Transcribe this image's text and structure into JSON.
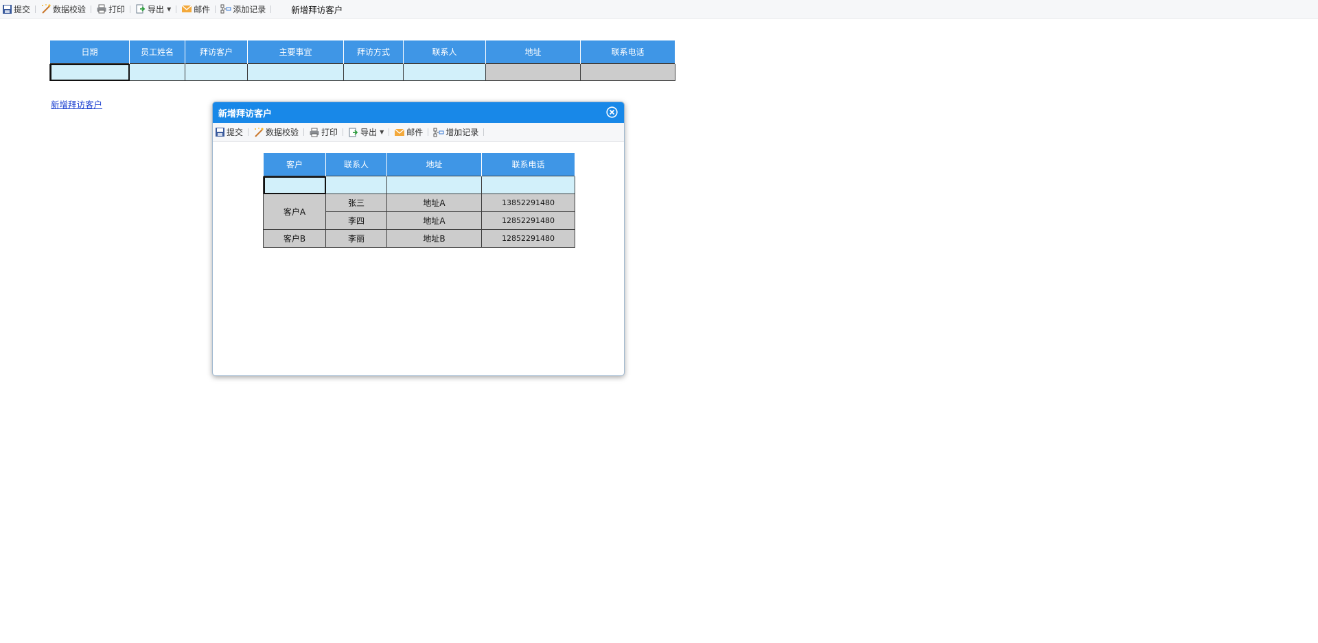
{
  "toolbar": {
    "submit": "提交",
    "validate": "数据校验",
    "print": "打印",
    "export": "导出",
    "mail": "邮件",
    "add_record": "添加记录",
    "title": "新增拜访客户"
  },
  "main_table": {
    "headers": [
      "日期",
      "员工姓名",
      "拜访客户",
      "主要事宜",
      "拜访方式",
      "联系人",
      "地址",
      "联系电话"
    ]
  },
  "link": {
    "new_visit": "新增拜访客户"
  },
  "dialog": {
    "title": "新增拜访客户",
    "toolbar": {
      "submit": "提交",
      "validate": "数据校验",
      "print": "打印",
      "export": "导出",
      "mail": "邮件",
      "add_record": "增加记录"
    },
    "table": {
      "headers": [
        "客户",
        "联系人",
        "地址",
        "联系电话"
      ],
      "groups": [
        {
          "customer": "客户A",
          "rows": [
            {
              "contact": "张三",
              "address": "地址A",
              "phone": "13852291480"
            },
            {
              "contact": "李四",
              "address": "地址A",
              "phone": "12852291480"
            }
          ]
        },
        {
          "customer": "客户B",
          "rows": [
            {
              "contact": "李丽",
              "address": "地址B",
              "phone": "12852291480"
            }
          ]
        }
      ]
    }
  },
  "colors": {
    "header_blue": "#3f96e6",
    "input_cell": "#d2f0fa",
    "readonly_cell": "#cccccc",
    "dialog_title_bar": "#1888e8",
    "link": "#1a3fd0"
  }
}
